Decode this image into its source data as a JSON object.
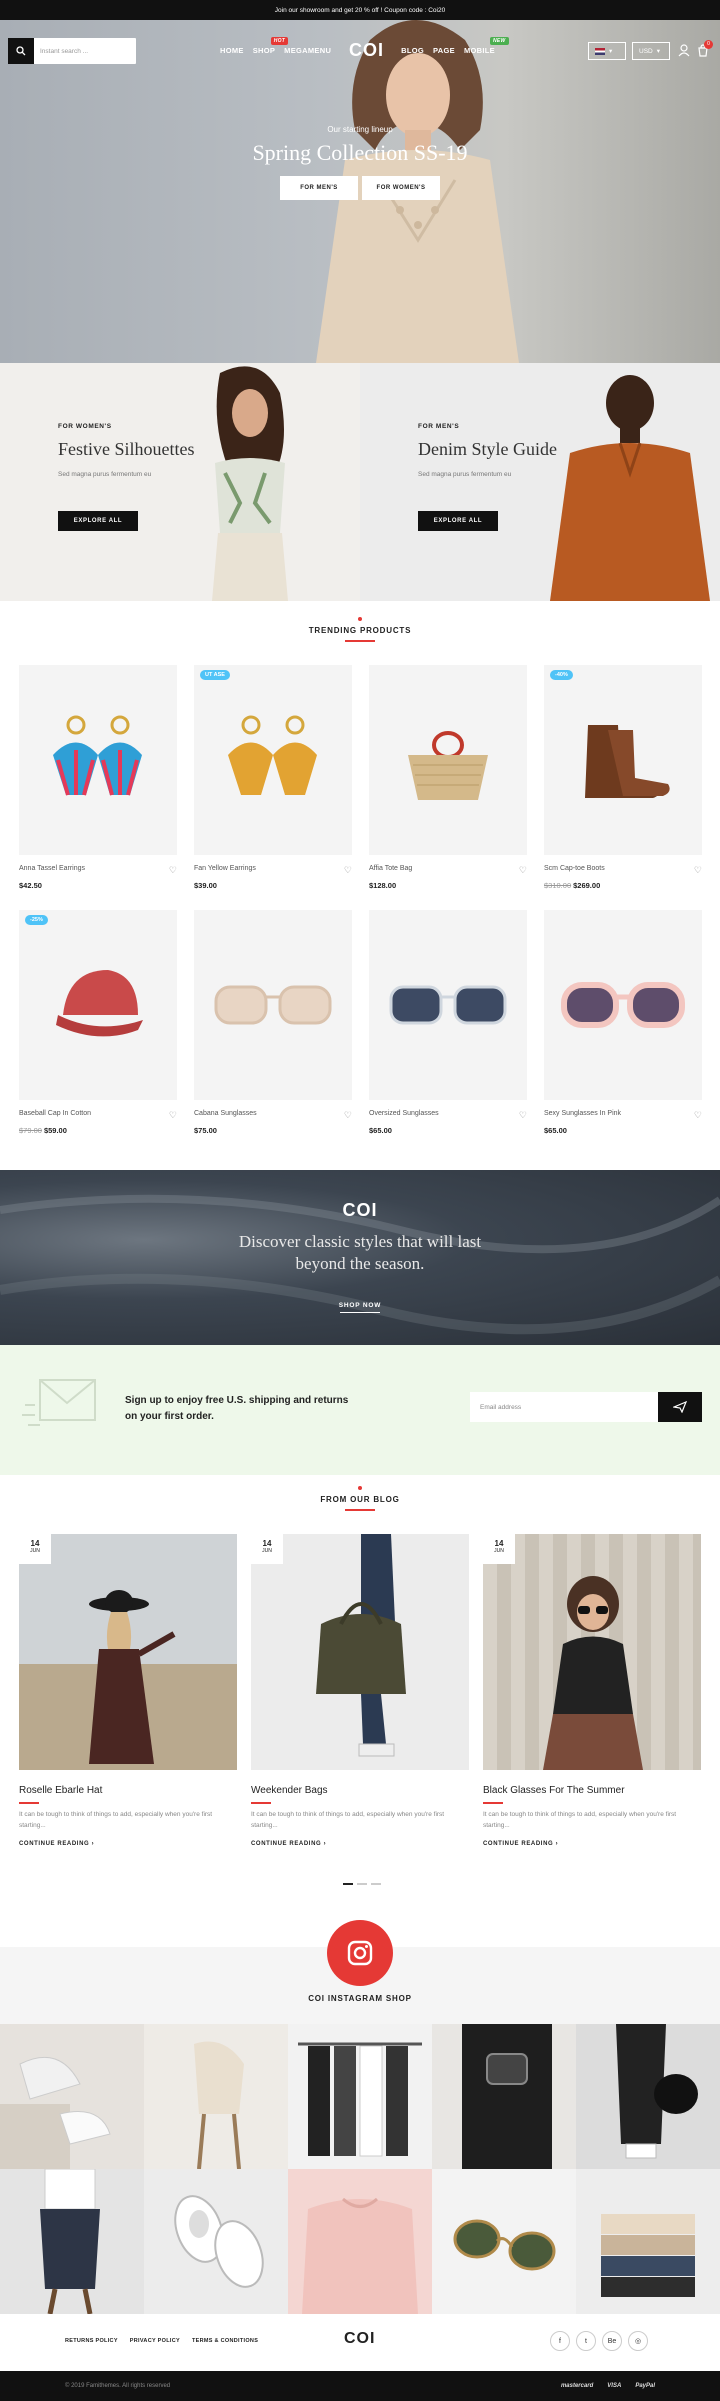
{
  "topbar": {
    "text": "Join our showroom and get 20 % off ! Coupon code : Coi20"
  },
  "search": {
    "placeholder": "Instant search ..."
  },
  "nav": {
    "items": [
      {
        "label": "HOME"
      },
      {
        "label": "SHOP",
        "badge": "HOT"
      },
      {
        "label": "MEGAMENU"
      },
      {
        "label": "BLOG"
      },
      {
        "label": "PAGE"
      },
      {
        "label": "MOBILE",
        "badge": "NEW"
      }
    ],
    "logo": "COI",
    "currency": "USD",
    "cart_count": "0"
  },
  "hero": {
    "subtitle": "Our starting lineup",
    "title": "Spring Collection SS-19",
    "btn_men": "FOR MEN'S",
    "btn_women": "FOR WOMEN'S"
  },
  "banners": [
    {
      "eyebrow": "FOR WOMEN'S",
      "title": "Festive Silhouettes",
      "text": "Sed magna purus fermentum eu",
      "button": "EXPLORE ALL"
    },
    {
      "eyebrow": "FOR MEN'S",
      "title": "Denim Style Guide",
      "text": "Sed magna purus fermentum eu",
      "button": "EXPLORE ALL"
    }
  ],
  "trending": {
    "title": "TRENDING PRODUCTS",
    "products": [
      {
        "name": "Anna Tassel Earrings",
        "price": "$42.50",
        "old": "",
        "tag": ""
      },
      {
        "name": "Fan Yellow Earrings",
        "price": "$39.00",
        "old": "",
        "tag": "UT ASE"
      },
      {
        "name": "Affia Tote Bag",
        "price": "$128.00",
        "old": "",
        "tag": ""
      },
      {
        "name": "Scm Cap-toe Boots",
        "price": "$269.00",
        "old": "$310.00",
        "tag": "-40%"
      },
      {
        "name": "Baseball Cap In Cotton",
        "price": "$59.00",
        "old": "$79.00",
        "tag": "-25%"
      },
      {
        "name": "Cabana Sunglasses",
        "price": "$75.00",
        "old": "",
        "tag": ""
      },
      {
        "name": "Oversized Sunglasses",
        "price": "$65.00",
        "old": "",
        "tag": ""
      },
      {
        "name": "Sexy Sunglasses In Pink",
        "price": "$65.00",
        "old": "",
        "tag": ""
      }
    ]
  },
  "promo": {
    "logo": "COI",
    "line1": "Discover classic styles that will last",
    "line2": "beyond the season.",
    "button": "SHOP NOW"
  },
  "newsletter": {
    "line1": "Sign up to enjoy free U.S. shipping and returns",
    "line2": "on your first order.",
    "placeholder": "Email address"
  },
  "blog": {
    "title": "FROM OUR BLOG",
    "posts": [
      {
        "day": "14",
        "month": "JUN",
        "title": "Roselle Ebarle Hat",
        "desc": "It can be tough to think of things to add, especially when you're first starting...",
        "more": "CONTINUE READING"
      },
      {
        "day": "14",
        "month": "JUN",
        "title": "Weekender Bags",
        "desc": "It can be tough to think of things to add, especially when you're first starting...",
        "more": "CONTINUE READING"
      },
      {
        "day": "14",
        "month": "JUN",
        "title": "Black Glasses For The Summer",
        "desc": "It can be tough to think of things to add, especially when you're first starting...",
        "more": "CONTINUE READING"
      }
    ]
  },
  "instagram": {
    "title": "COI INSTAGRAM SHOP"
  },
  "footer": {
    "links": [
      "RETURNS POLICY",
      "PRIVACY POLICY",
      "TERMS & CONDITIONS"
    ],
    "logo": "COI",
    "social": [
      "f",
      "t",
      "Be",
      "◎"
    ],
    "copyright": "© 2019 Famithemes. All rights reserved",
    "payments": [
      "mastercard",
      "VISA",
      "PayPal"
    ]
  },
  "colors": {
    "accent": "#e53935",
    "tag": "#4fc3f7",
    "dark": "#111111",
    "newsletter_bg": "#eef8ea"
  }
}
